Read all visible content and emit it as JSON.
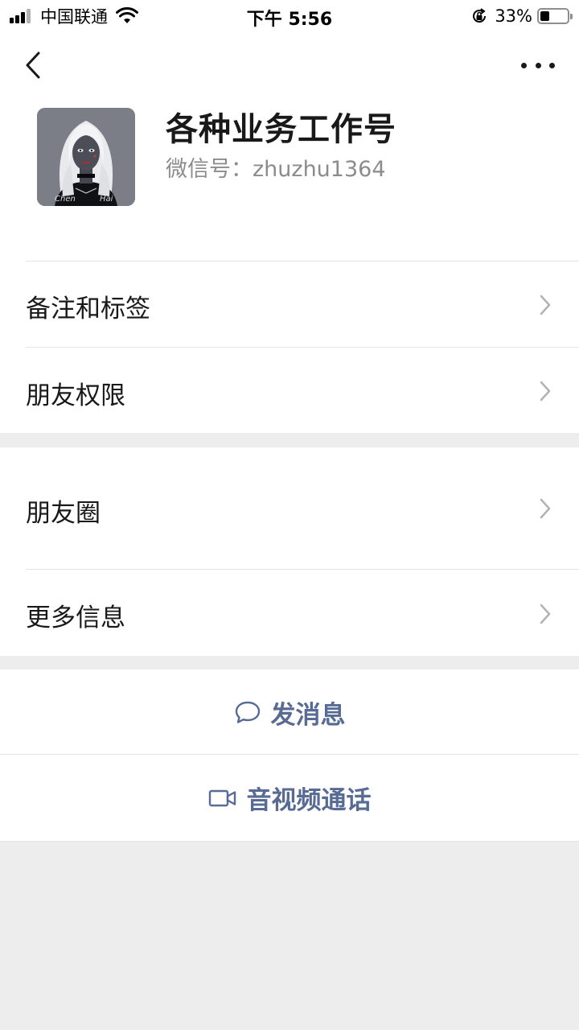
{
  "status_bar": {
    "carrier": "中国联通",
    "time": "下午 5:56",
    "battery_percent": "33%",
    "battery_level": 0.33,
    "signal_icon": "cellular-signal-icon",
    "wifi_icon": "wifi-icon",
    "rotation_lock_icon": "rotation-lock-icon"
  },
  "nav": {
    "back_icon": "chevron-left-icon",
    "more_icon": "more-dots-icon"
  },
  "profile": {
    "nickname": "各种业务工作号",
    "wechat_id_label": "微信号：zhuzhu1364",
    "avatar_caption_left": "Chen",
    "avatar_caption_right": "Hai"
  },
  "settings": {
    "remark_tags": "备注和标签",
    "friend_permissions": "朋友权限",
    "moments": "朋友圈",
    "more_info": "更多信息"
  },
  "actions": {
    "send_message": "发消息",
    "send_message_icon": "chat-bubble-icon",
    "av_call": "音视频通话",
    "av_call_icon": "video-camera-icon"
  },
  "colors": {
    "accent_link": "#576b95",
    "background": "#ededed",
    "card": "#ffffff",
    "secondary_text": "#8c8c8c"
  }
}
